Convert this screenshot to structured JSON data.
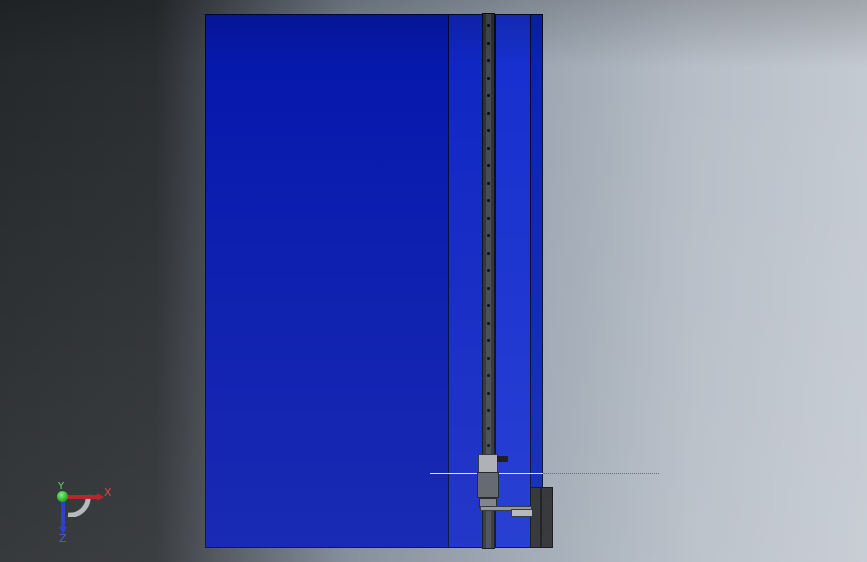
{
  "viewport": {
    "background_colors": [
      "#26292c",
      "#9aa4b0",
      "#c4cad2"
    ]
  },
  "model": {
    "panel_color": "#0619ad",
    "rail_color": "#2e3138",
    "carriage_color": "#a9adb3"
  },
  "triad": {
    "x_label": "X",
    "y_label": "Y",
    "z_label": "Z",
    "x_color": "#b8141b",
    "y_color": "#139a13",
    "z_color": "#1f31c8"
  }
}
